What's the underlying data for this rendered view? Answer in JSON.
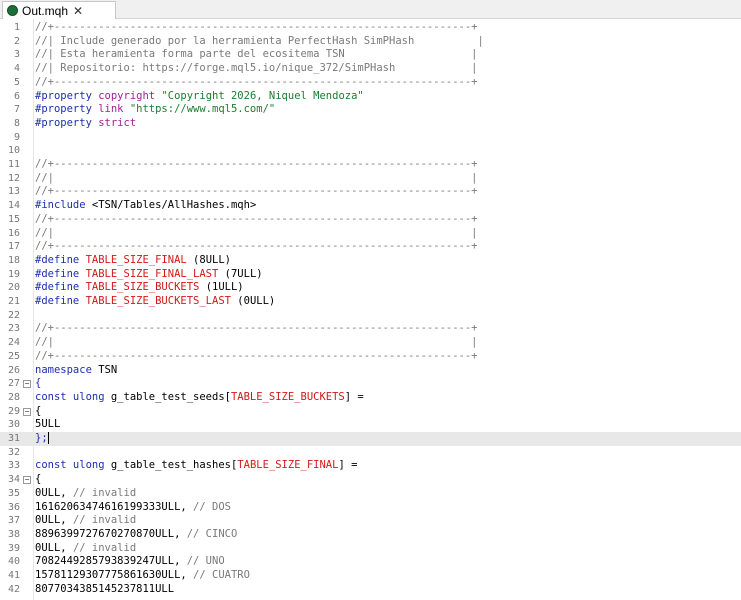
{
  "tab": {
    "label": "Out.mqh",
    "close": "✕"
  },
  "lines": [
    {
      "n": "1",
      "fold": "",
      "segs": [
        {
          "t": "//+------------------------------------------------------------------+",
          "c": "c-comment"
        }
      ]
    },
    {
      "n": "2",
      "fold": "",
      "segs": [
        {
          "t": "//| Include generado por la herramienta PerfectHash SimPHash          |",
          "c": "c-comment"
        }
      ]
    },
    {
      "n": "3",
      "fold": "",
      "segs": [
        {
          "t": "//| Esta heramienta forma parte del ecositema TSN                    |",
          "c": "c-comment"
        }
      ]
    },
    {
      "n": "4",
      "fold": "",
      "segs": [
        {
          "t": "//| Repositorio: https://forge.mql5.io/nique_372/SimPHash            |",
          "c": "c-comment"
        }
      ]
    },
    {
      "n": "5",
      "fold": "",
      "segs": [
        {
          "t": "//+------------------------------------------------------------------+",
          "c": "c-comment"
        }
      ]
    },
    {
      "n": "6",
      "fold": "",
      "segs": [
        {
          "t": "#property ",
          "c": "c-kw"
        },
        {
          "t": "copyright ",
          "c": "c-prop"
        },
        {
          "t": "\"Copyright 2026, Niquel Mendoza\"",
          "c": "c-str"
        }
      ]
    },
    {
      "n": "7",
      "fold": "",
      "segs": [
        {
          "t": "#property ",
          "c": "c-kw"
        },
        {
          "t": "link ",
          "c": "c-prop"
        },
        {
          "t": "\"https://www.mql5.com/\"",
          "c": "c-str"
        }
      ]
    },
    {
      "n": "8",
      "fold": "",
      "segs": [
        {
          "t": "#property ",
          "c": "c-kw"
        },
        {
          "t": "strict",
          "c": "c-prop"
        }
      ]
    },
    {
      "n": "9",
      "fold": "",
      "segs": []
    },
    {
      "n": "10",
      "fold": "",
      "segs": []
    },
    {
      "n": "11",
      "fold": "",
      "segs": [
        {
          "t": "//+------------------------------------------------------------------+",
          "c": "c-comment"
        }
      ]
    },
    {
      "n": "12",
      "fold": "",
      "segs": [
        {
          "t": "//|                                                                  |",
          "c": "c-comment"
        }
      ]
    },
    {
      "n": "13",
      "fold": "",
      "segs": [
        {
          "t": "//+------------------------------------------------------------------+",
          "c": "c-comment"
        }
      ]
    },
    {
      "n": "14",
      "fold": "",
      "segs": [
        {
          "t": "#include ",
          "c": "c-kw"
        },
        {
          "t": "<TSN/Tables/AllHashes.mqh>",
          "c": "c-num"
        }
      ]
    },
    {
      "n": "15",
      "fold": "",
      "segs": [
        {
          "t": "//+------------------------------------------------------------------+",
          "c": "c-comment"
        }
      ]
    },
    {
      "n": "16",
      "fold": "",
      "segs": [
        {
          "t": "//|                                                                  |",
          "c": "c-comment"
        }
      ]
    },
    {
      "n": "17",
      "fold": "",
      "segs": [
        {
          "t": "//+------------------------------------------------------------------+",
          "c": "c-comment"
        }
      ]
    },
    {
      "n": "18",
      "fold": "",
      "segs": [
        {
          "t": "#define ",
          "c": "c-kw"
        },
        {
          "t": "TABLE_SIZE_FINAL",
          "c": "c-macro"
        },
        {
          "t": " (8ULL)",
          "c": "c-num"
        }
      ]
    },
    {
      "n": "19",
      "fold": "",
      "segs": [
        {
          "t": "#define ",
          "c": "c-kw"
        },
        {
          "t": "TABLE_SIZE_FINAL_LAST",
          "c": "c-macro"
        },
        {
          "t": " (7ULL)",
          "c": "c-num"
        }
      ]
    },
    {
      "n": "20",
      "fold": "",
      "segs": [
        {
          "t": "#define ",
          "c": "c-kw"
        },
        {
          "t": "TABLE_SIZE_BUCKETS",
          "c": "c-macro"
        },
        {
          "t": " (1ULL)",
          "c": "c-num"
        }
      ]
    },
    {
      "n": "21",
      "fold": "",
      "segs": [
        {
          "t": "#define ",
          "c": "c-kw"
        },
        {
          "t": "TABLE_SIZE_BUCKETS_LAST",
          "c": "c-macro"
        },
        {
          "t": " (0ULL)",
          "c": "c-num"
        }
      ]
    },
    {
      "n": "22",
      "fold": "",
      "segs": []
    },
    {
      "n": "23",
      "fold": "",
      "segs": [
        {
          "t": "//+------------------------------------------------------------------+",
          "c": "c-comment"
        }
      ]
    },
    {
      "n": "24",
      "fold": "",
      "segs": [
        {
          "t": "//|                                                                  |",
          "c": "c-comment"
        }
      ]
    },
    {
      "n": "25",
      "fold": "",
      "segs": [
        {
          "t": "//+------------------------------------------------------------------+",
          "c": "c-comment"
        }
      ]
    },
    {
      "n": "26",
      "fold": "",
      "segs": [
        {
          "t": "namespace ",
          "c": "c-kw"
        },
        {
          "t": "TSN",
          "c": "c-num"
        }
      ]
    },
    {
      "n": "27",
      "fold": "⊟",
      "segs": [
        {
          "t": "{",
          "c": "c-kw"
        }
      ]
    },
    {
      "n": "28",
      "fold": "",
      "segs": [
        {
          "t": "const ulong ",
          "c": "c-kw"
        },
        {
          "t": "g_table_test_seeds[",
          "c": "c-num"
        },
        {
          "t": "TABLE_SIZE_BUCKETS",
          "c": "c-macro"
        },
        {
          "t": "] =",
          "c": "c-num"
        }
      ]
    },
    {
      "n": "29",
      "fold": "⊟",
      "segs": [
        {
          "t": "{",
          "c": "c-num"
        }
      ]
    },
    {
      "n": "30",
      "fold": "",
      "segs": [
        {
          "t": "5ULL",
          "c": "c-num"
        }
      ]
    },
    {
      "n": "31",
      "fold": "",
      "hl": true,
      "segs": [
        {
          "t": "};",
          "c": "c-kw"
        }
      ]
    },
    {
      "n": "32",
      "fold": "",
      "segs": []
    },
    {
      "n": "33",
      "fold": "",
      "segs": [
        {
          "t": "const ulong ",
          "c": "c-kw"
        },
        {
          "t": "g_table_test_hashes[",
          "c": "c-num"
        },
        {
          "t": "TABLE_SIZE_FINAL",
          "c": "c-macro"
        },
        {
          "t": "] =",
          "c": "c-num"
        }
      ]
    },
    {
      "n": "34",
      "fold": "⊟",
      "segs": [
        {
          "t": "{",
          "c": "c-num"
        }
      ]
    },
    {
      "n": "35",
      "fold": "",
      "segs": [
        {
          "t": "0ULL, ",
          "c": "c-num"
        },
        {
          "t": "// invalid",
          "c": "c-comment"
        }
      ]
    },
    {
      "n": "36",
      "fold": "",
      "segs": [
        {
          "t": "16162063474616199333ULL, ",
          "c": "c-num"
        },
        {
          "t": "// DOS",
          "c": "c-comment"
        }
      ]
    },
    {
      "n": "37",
      "fold": "",
      "segs": [
        {
          "t": "0ULL, ",
          "c": "c-num"
        },
        {
          "t": "// invalid",
          "c": "c-comment"
        }
      ]
    },
    {
      "n": "38",
      "fold": "",
      "segs": [
        {
          "t": "8896399727670270870ULL, ",
          "c": "c-num"
        },
        {
          "t": "// CINCO",
          "c": "c-comment"
        }
      ]
    },
    {
      "n": "39",
      "fold": "",
      "segs": [
        {
          "t": "0ULL, ",
          "c": "c-num"
        },
        {
          "t": "// invalid",
          "c": "c-comment"
        }
      ]
    },
    {
      "n": "40",
      "fold": "",
      "segs": [
        {
          "t": "7082449285793839247ULL, ",
          "c": "c-num"
        },
        {
          "t": "// UNO",
          "c": "c-comment"
        }
      ]
    },
    {
      "n": "41",
      "fold": "",
      "segs": [
        {
          "t": "15781129307775861630ULL, ",
          "c": "c-num"
        },
        {
          "t": "// CUATRO",
          "c": "c-comment"
        }
      ]
    },
    {
      "n": "42",
      "fold": "",
      "segs": [
        {
          "t": "8077034385145237811ULL",
          "c": "c-num"
        }
      ]
    }
  ]
}
